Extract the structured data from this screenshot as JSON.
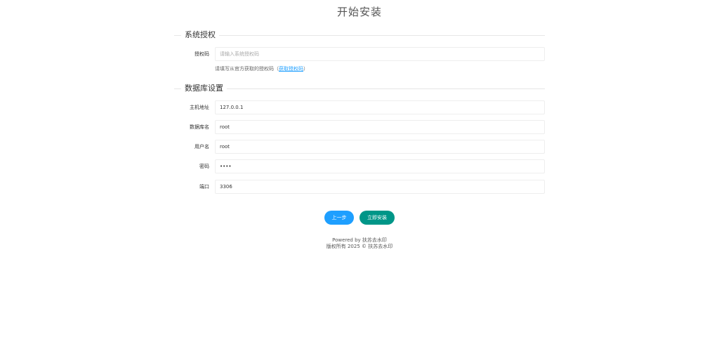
{
  "page": {
    "title": "开始安装"
  },
  "license_section": {
    "legend": "系统授权",
    "fields": [
      {
        "label": "授权码",
        "value": "",
        "placeholder": "请输入系统授权码"
      }
    ],
    "hint": {
      "prefix": "请填写从官方获取的授权码（",
      "link": "获取授权码",
      "suffix": "）"
    }
  },
  "database_section": {
    "legend": "数据库设置",
    "fields": [
      {
        "label": "主机地址",
        "value": "127.0.0.1",
        "type": "text"
      },
      {
        "label": "数据库名",
        "value": "root",
        "type": "text"
      },
      {
        "label": "用户名",
        "value": "root",
        "type": "text"
      },
      {
        "label": "密码",
        "value": "root",
        "type": "password"
      },
      {
        "label": "端口",
        "value": "3306",
        "type": "text"
      }
    ]
  },
  "buttons": {
    "prev_label": "上一步",
    "install_label": "立即安装"
  },
  "colors": {
    "prev_button": "#1e9fff",
    "install_button": "#009688",
    "link": "#1e9fff"
  },
  "footer": {
    "powered_by": "Powered by 扶苏去水印",
    "copyright": "版权所有 2025 © 扶苏去水印"
  }
}
